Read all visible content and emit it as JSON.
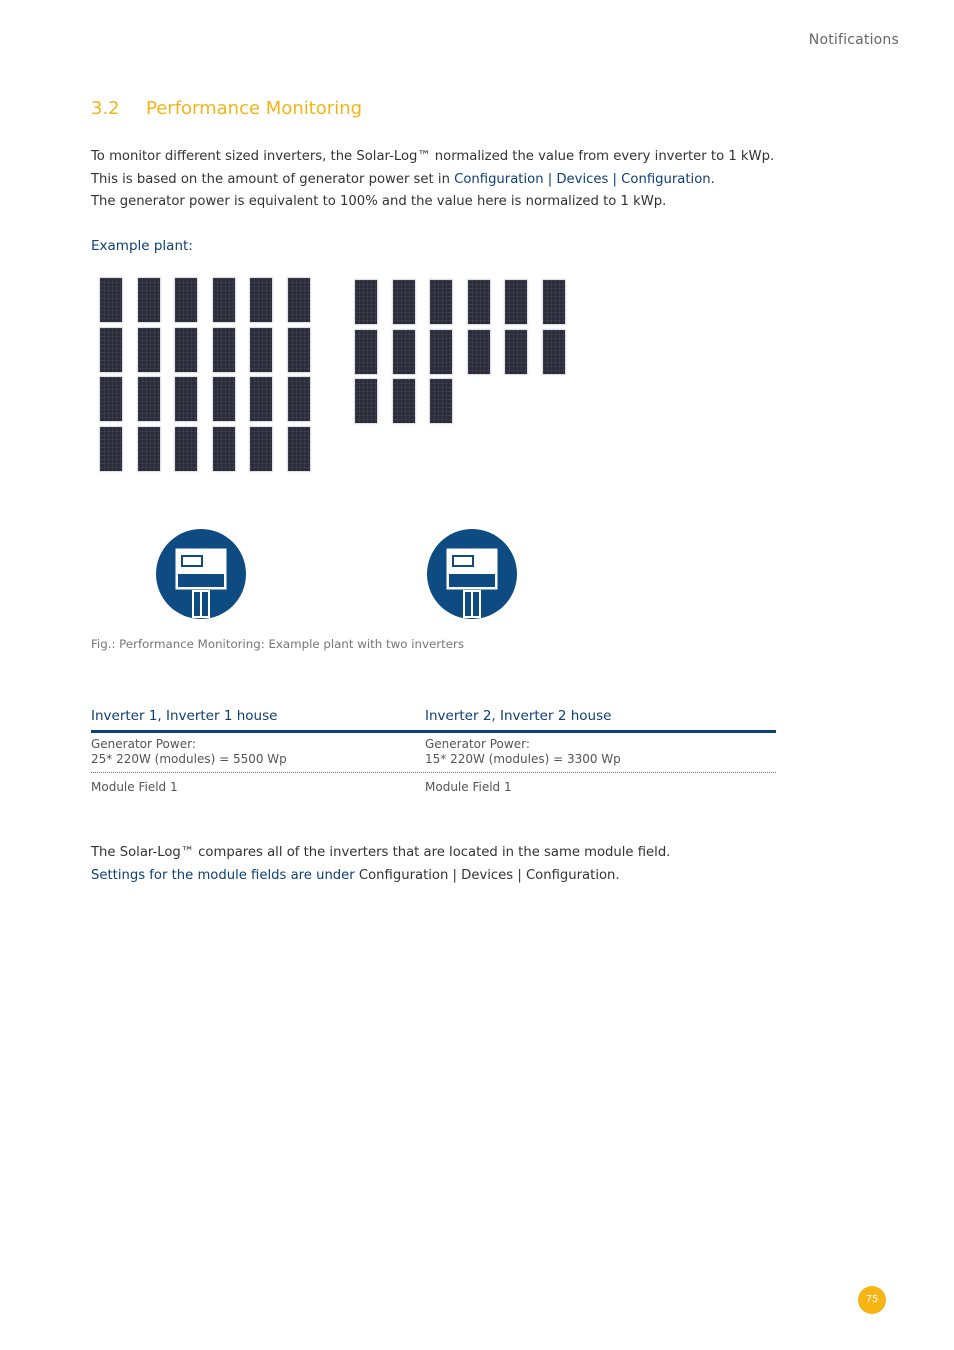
{
  "header": {
    "title": "Notifications"
  },
  "section": {
    "number": "3.2",
    "title": "Performance Monitoring"
  },
  "intro": {
    "line1": "To monitor different sized inverters, the Solar-Log™ normalized the value from every inverter to 1 kWp.",
    "line2_prefix": "This is based on the amount of generator power set in ",
    "line2_link": "Configuration | Devices | Configuration",
    "line2_suffix": ".",
    "line3": "The generator power is equivalent to 100% and the value here is normalized to 1 kWp."
  },
  "example_label": "Example plant:",
  "figure": {
    "array1_modules": 24,
    "array2_modules": 15,
    "inverter_count": 2,
    "caption": "Fig.: Performance Monitoring: Example plant with two inverters"
  },
  "table": {
    "columns": [
      {
        "header": "Inverter 1, Inverter 1 house",
        "gen_label": "Generator Power:",
        "gen_value": "25* 220W (modules) = 5500 Wp",
        "module_field": "Module Field 1"
      },
      {
        "header": "Inverter 2, Inverter 2 house",
        "gen_label": "Generator Power:",
        "gen_value": "15* 220W (modules) = 3300 Wp",
        "module_field": "Module Field 1"
      }
    ]
  },
  "outro": {
    "line1": "The Solar-Log™ compares all of the inverters that are located in the same module field.",
    "line2_link": "Settings for the module fields are under",
    "line2_suffix": " Configuration | Devices | Configuration."
  },
  "footer": {
    "page_number": "75"
  },
  "colors": {
    "accent": "#f5b416",
    "link": "#0e3f75",
    "inverter": "#0d4b82"
  }
}
